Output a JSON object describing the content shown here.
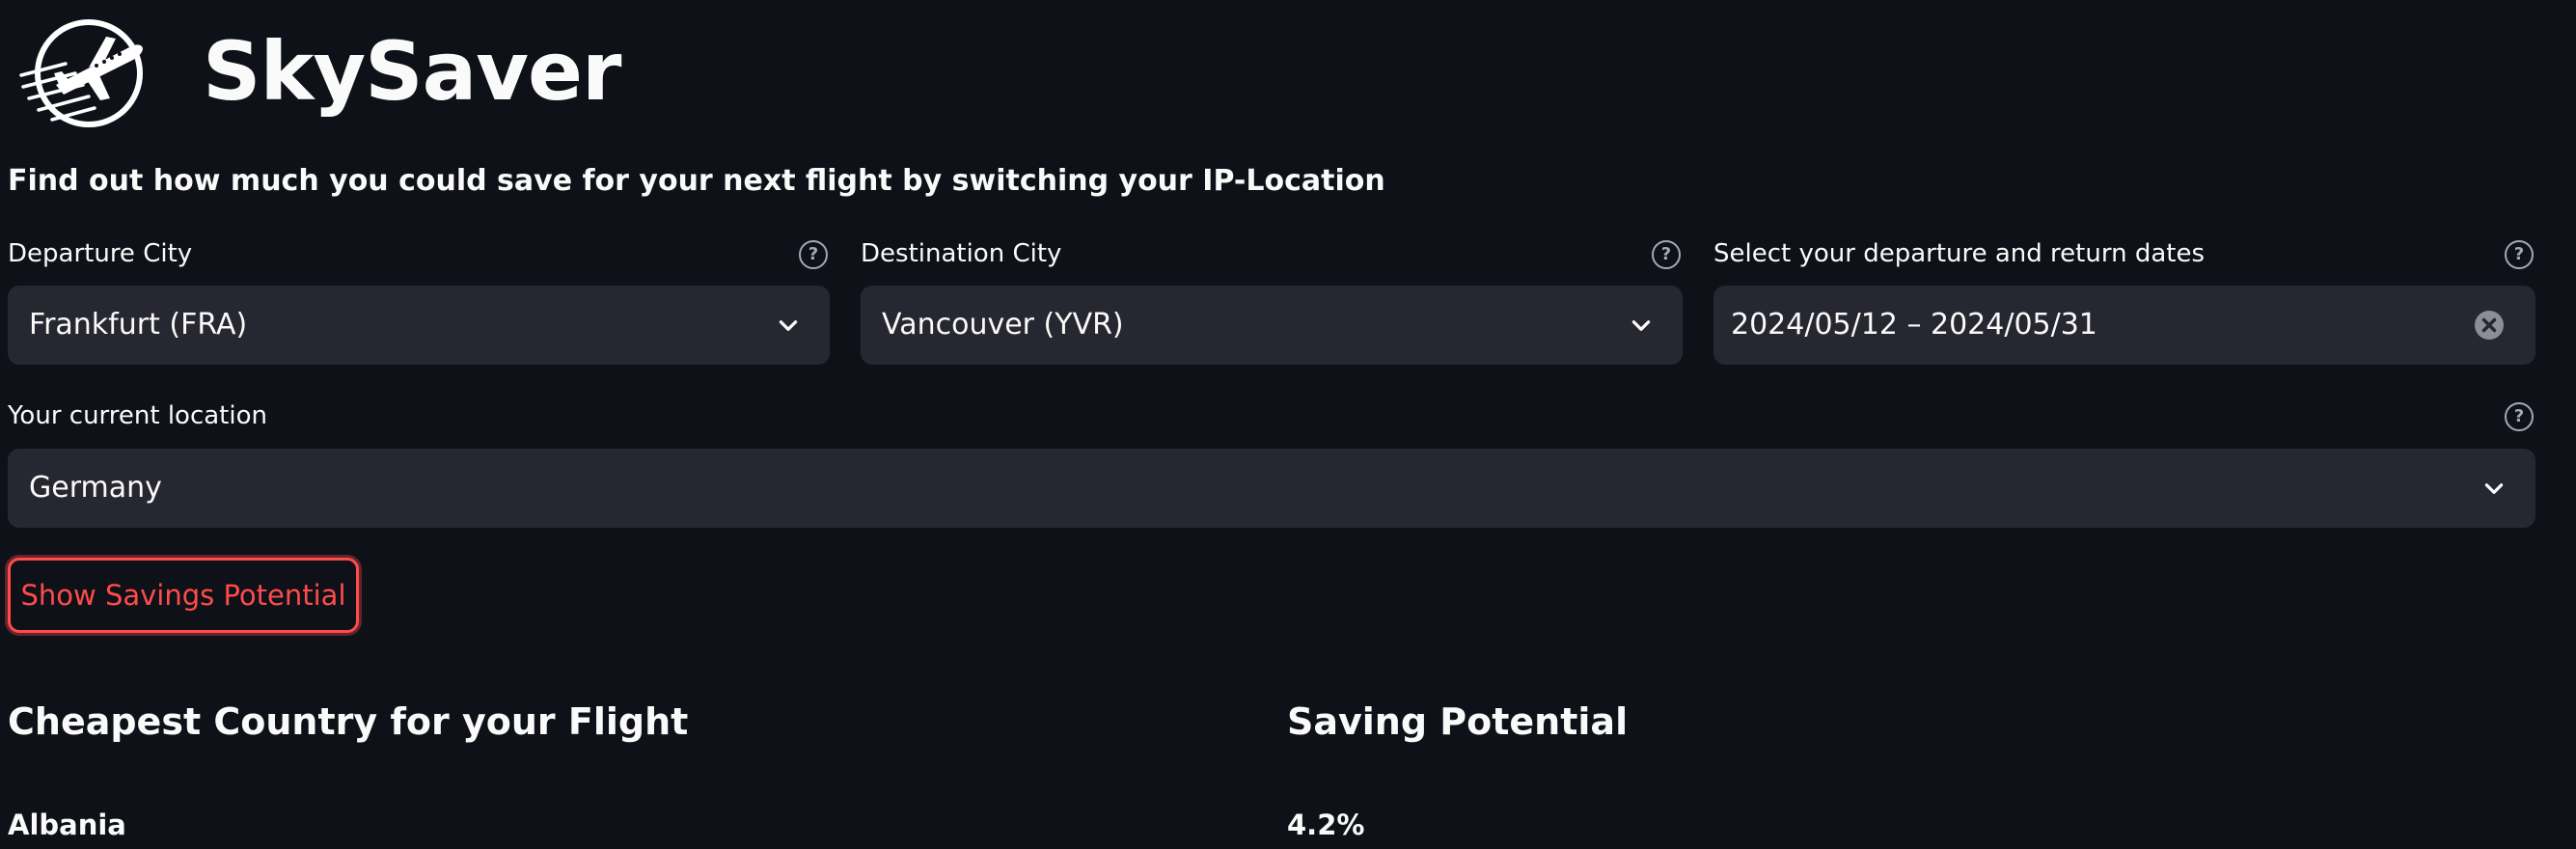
{
  "app": {
    "title": "SkySaver",
    "subtitle": "Find out how much you could save for your next flight by switching your IP-Location"
  },
  "form": {
    "departure": {
      "label": "Departure City",
      "value": "Frankfurt (FRA)"
    },
    "destination": {
      "label": "Destination City",
      "value": "Vancouver (YVR)"
    },
    "dates": {
      "label": "Select your departure and return dates",
      "value": "2024/05/12 – 2024/05/31"
    },
    "location": {
      "label": "Your current location",
      "value": "Germany"
    },
    "help_glyph": "?"
  },
  "button": {
    "label": "Show Savings Potential"
  },
  "results": {
    "columns": [
      "Cheapest Country for your Flight",
      "Saving Potential"
    ],
    "rows": [
      [
        "Albania",
        "4.2%"
      ]
    ]
  },
  "colors": {
    "background": "#0e1117",
    "input_bg": "#262730",
    "accent": "#ff4b4b",
    "text": "#fafafa"
  },
  "icons": [
    "plane-logo-icon",
    "help-icon",
    "chevron-down-icon",
    "clear-icon"
  ]
}
